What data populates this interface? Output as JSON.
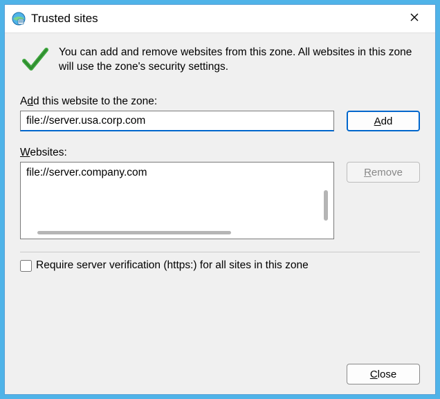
{
  "titlebar": {
    "title": "Trusted sites"
  },
  "info": {
    "text": "You can add and remove websites from this zone. All websites in this zone will use the zone's security settings."
  },
  "addSection": {
    "label_pre": "A",
    "label_ul": "d",
    "label_post": "d this website to the zone:",
    "value": "file://server.usa.corp.com",
    "button_ul": "A",
    "button_post": "dd"
  },
  "websitesSection": {
    "label_ul": "W",
    "label_post": "ebsites:",
    "items": [
      "file://server.company.com"
    ],
    "remove_ul": "R",
    "remove_post": "emove",
    "remove_disabled": true
  },
  "checkbox": {
    "checked": false,
    "label_pre": "Require ",
    "label_ul": "s",
    "label_post": "erver verification (https:) for all sites in this zone"
  },
  "footer": {
    "close_ul": "C",
    "close_post": "lose"
  }
}
